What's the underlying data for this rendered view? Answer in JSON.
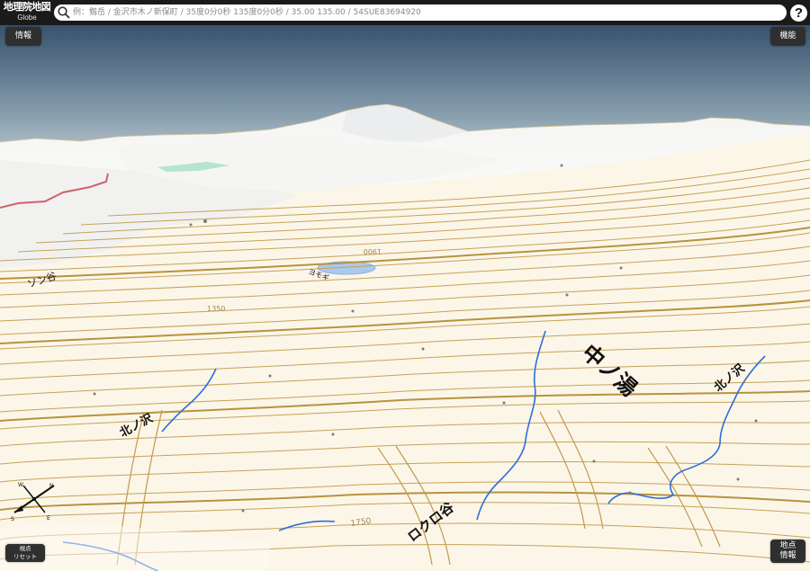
{
  "app": {
    "title": "地理院地図",
    "subtitle": "Globe"
  },
  "search": {
    "placeholder": "例：剱岳 / 金沢市木ノ新保町 / 35度0分0秒 135度0分0秒 / 35.00 135.00 / 54SUE83694920",
    "icon": "search-icon"
  },
  "help": {
    "label": "?",
    "icon": "help-icon"
  },
  "buttons": {
    "info": "情報",
    "functions": "機能",
    "view_reset_line1": "視点",
    "view_reset_line2": "リセット",
    "point_info_line1": "地点",
    "point_info_line2": "情報"
  },
  "map": {
    "labels": {
      "sawa_left": "北ノ沢",
      "sawa_center": "ロクロ谷",
      "sawa_right": "北ノ沢",
      "place_center": "中ノ湯",
      "area_left": "ソン谷",
      "pond_label": "ヨモギ",
      "contour_1900": "1900",
      "contour_1350": "1350",
      "contour_1750": "1750"
    },
    "compass_icon": "compass-icon",
    "colors": {
      "sky_top": "#3a5878",
      "sky_bottom": "#b7c6cd",
      "ground": "#fbf6e8",
      "contour": "#c7a25a",
      "river": "#2f6fd6",
      "pond": "#a9c9ee",
      "road": "#d0626a",
      "snow": "#f2f2f2"
    }
  }
}
